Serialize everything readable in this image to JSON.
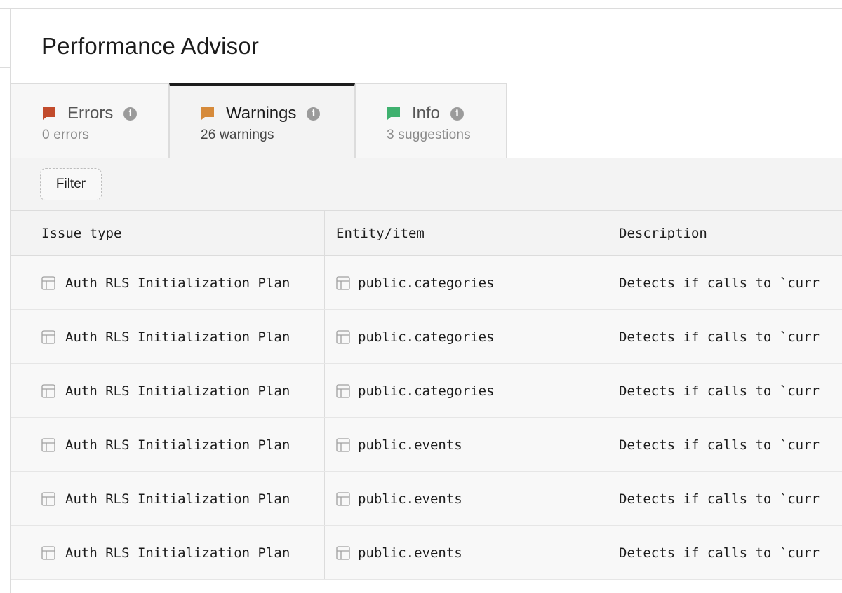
{
  "page": {
    "title": "Performance Advisor"
  },
  "tabs": [
    {
      "label": "Errors",
      "count_text": "0 errors",
      "flag_color": "#c24b2c",
      "active": false
    },
    {
      "label": "Warnings",
      "count_text": "26 warnings",
      "flag_color": "#d68a3a",
      "active": true
    },
    {
      "label": "Info",
      "count_text": "3 suggestions",
      "flag_color": "#3fb16f",
      "active": false
    }
  ],
  "toolbar": {
    "filter_label": "Filter"
  },
  "table": {
    "columns": [
      "Issue type",
      "Entity/item",
      "Description"
    ],
    "rows": [
      {
        "issue": "Auth RLS Initialization Plan",
        "entity": "public.categories",
        "description": "Detects if calls to `curr"
      },
      {
        "issue": "Auth RLS Initialization Plan",
        "entity": "public.categories",
        "description": "Detects if calls to `curr"
      },
      {
        "issue": "Auth RLS Initialization Plan",
        "entity": "public.categories",
        "description": "Detects if calls to `curr"
      },
      {
        "issue": "Auth RLS Initialization Plan",
        "entity": "public.events",
        "description": "Detects if calls to `curr"
      },
      {
        "issue": "Auth RLS Initialization Plan",
        "entity": "public.events",
        "description": "Detects if calls to `curr"
      },
      {
        "issue": "Auth RLS Initialization Plan",
        "entity": "public.events",
        "description": "Detects if calls to `curr"
      }
    ]
  },
  "icons": {
    "tab_flag": "flag-icon",
    "tab_info": "info-icon",
    "row_cell": "table-icon"
  }
}
